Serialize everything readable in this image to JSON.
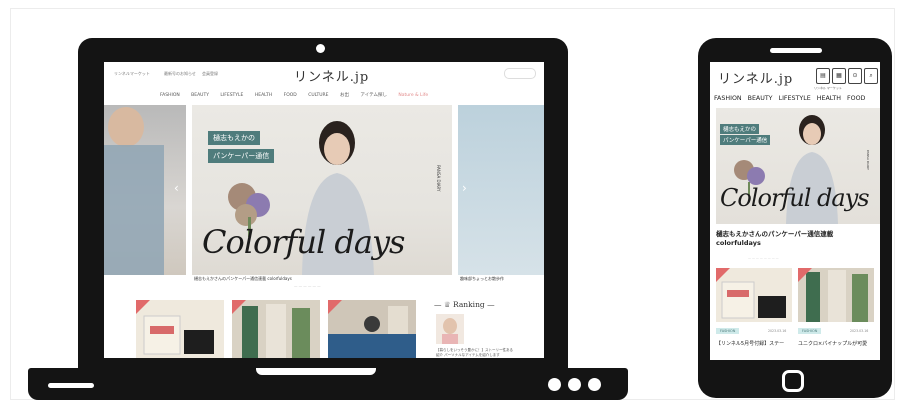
{
  "desktop": {
    "utility_links": [
      "リンネルマーケット",
      "最新号のお知らせ",
      "会員登録"
    ],
    "logo": "リンネル.jp",
    "nav": [
      "FASHION",
      "BEAUTY",
      "LIFESTYLE",
      "HEALTH",
      "FOOD",
      "CULTURE",
      "お出",
      "アイテム探し",
      "Nature & Life"
    ],
    "hero": {
      "tag_line1": "樋志もえかの",
      "tag_line2": "パンケーパー通信",
      "script_title": "Colorful days",
      "vertical_label": "PANSA DIARY",
      "caption_main": "樋志もえかさんのパンケーパー通信連載 colorfuldays",
      "caption_right": "趣味部ちょっとお散歩作"
    },
    "ranking_title": "Ranking",
    "ranking_snippet": "【暮らしをいっそう豊かに！】ストーリー性ある紹介 パーソナルなアイテムを紹介します"
  },
  "mobile": {
    "logo": "リンネル.jp",
    "icon_labels": [
      "リンネル マーケット",
      "最新号 のお知らせ",
      "会員登録",
      "検索"
    ],
    "nav": [
      "FASHION",
      "BEAUTY",
      "LIFESTYLE",
      "HEALTH",
      "FOOD"
    ],
    "hero": {
      "tag_line1": "樋志もえかの",
      "tag_line2": "パンケーパー通信",
      "script_title": "Colorful days",
      "vertical_label": "PANSA DIARY"
    },
    "article_title_line1": "樋志もえかさんのパンケーパー通信連載",
    "article_title_line2": "colorfuldays",
    "cards": [
      {
        "category": "FASHION",
        "date": "2023.03.16",
        "snippet": "【リンネル5月号付録】ステー"
      },
      {
        "category": "FASHION",
        "date": "2023.03.16",
        "snippet": "ユニクロ×パイナップルが可愛"
      }
    ]
  }
}
